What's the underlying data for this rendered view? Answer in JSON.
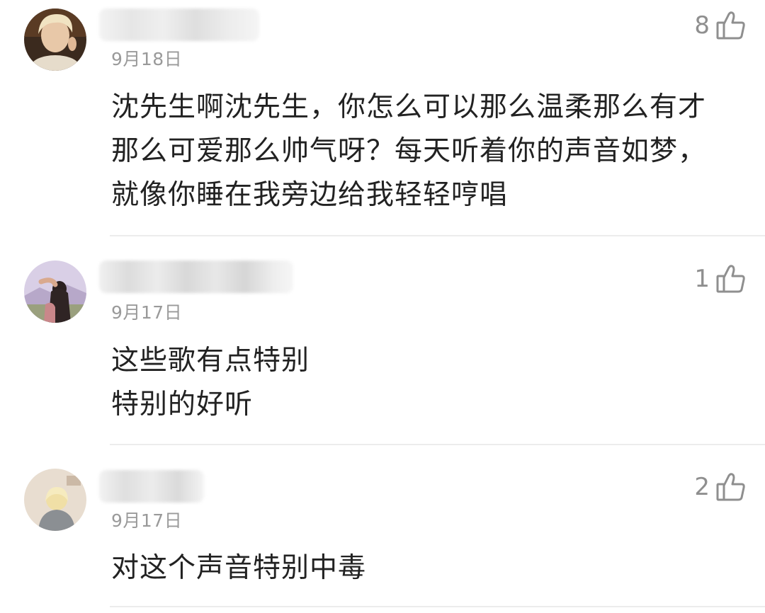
{
  "comments": [
    {
      "date": "9月18日",
      "likes": "8",
      "lines": [
        "沈先生啊沈先生，你怎么可以那么温柔那么有才",
        "那么可爱那么帅气呀？每天听着你的声音如梦，",
        "就像你睡在我旁边给我轻轻哼唱"
      ],
      "avatar_icon": "avatar-woman-blonde",
      "username_hidden": true
    },
    {
      "date": "9月17日",
      "likes": "1",
      "lines": [
        "这些歌有点特别",
        "特别的好听"
      ],
      "avatar_icon": "avatar-woman-mountains",
      "username_hidden": true
    },
    {
      "date": "9月17日",
      "likes": "2",
      "lines": [
        "对这个声音特别中毒"
      ],
      "avatar_icon": "avatar-blonde-person",
      "username_hidden": true
    }
  ],
  "icons": {
    "like": "thumb-up-icon"
  },
  "colors": {
    "text": "#222222",
    "meta": "#9a9a9a",
    "like": "#8f8f8f",
    "divider": "#ececec"
  }
}
